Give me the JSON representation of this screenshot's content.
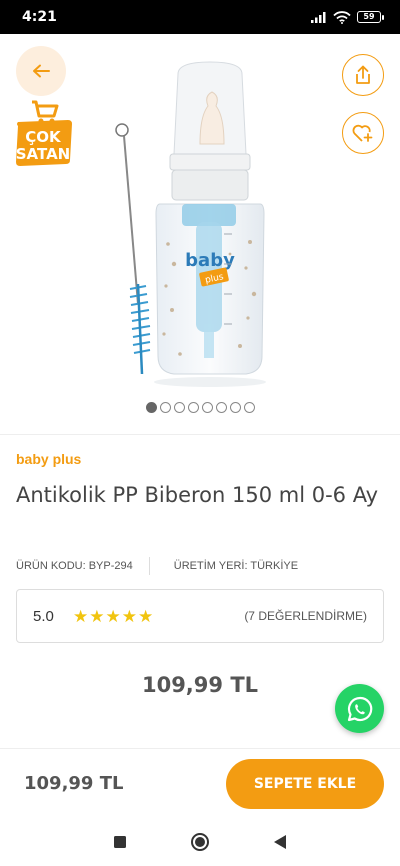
{
  "status_bar": {
    "time": "4:21",
    "battery": "59"
  },
  "badge": {
    "line1": "ÇOK",
    "line2": "SATAN"
  },
  "gallery": {
    "total": 8,
    "active": 0
  },
  "product": {
    "brand": "baby plus",
    "title": "Antikolik PP Biberon 150  ml 0-6 Ay",
    "code_label": "ÜRÜN KODU: BYP-294",
    "origin_label": "ÜRETİM YERİ: TÜRKİYE",
    "rating": "5.0",
    "stars": 5,
    "review_count": "(7 DEĞERLENDİRME)",
    "price": "109,99 TL"
  },
  "bottom_bar": {
    "price": "109,99 TL",
    "cart_button": "SEPETE EKLE"
  },
  "colors": {
    "accent": "#f39c12",
    "whatsapp": "#25d366",
    "star": "#f1c40f"
  },
  "icons": [
    "back-arrow-icon",
    "share-icon",
    "heart-plus-icon",
    "cart-icon",
    "whatsapp-icon",
    "square-nav-icon",
    "circle-nav-icon",
    "triangle-nav-icon"
  ]
}
